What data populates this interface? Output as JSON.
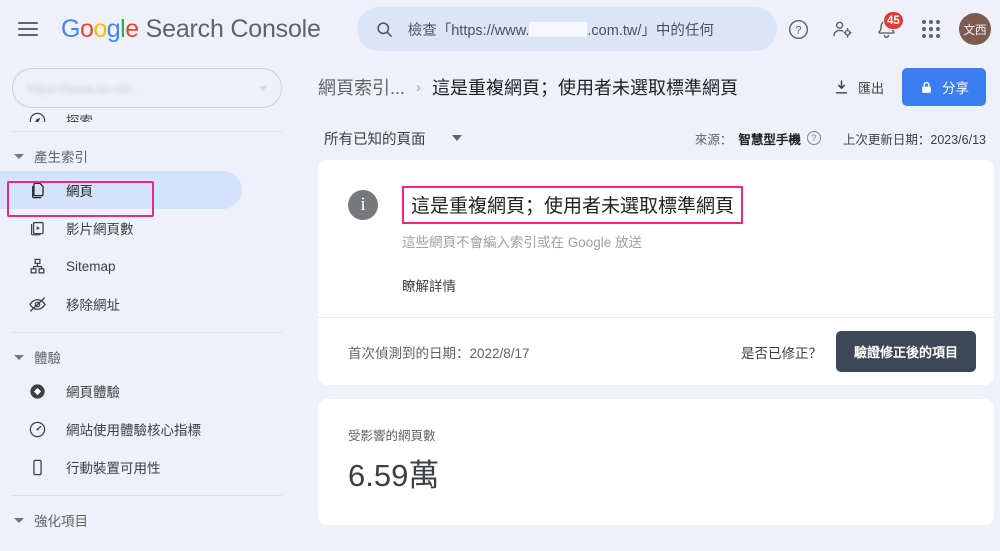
{
  "header": {
    "menu_icon": "hamburger-icon",
    "logo": {
      "g1": "G",
      "o1": "o",
      "o2": "o",
      "g2": "g",
      "l": "l",
      "e": "e",
      "rest": "Search Console"
    },
    "search": {
      "icon": "search-icon",
      "prefix": "檢查「https://www.",
      "suffix": ".com.tw/」中的任何"
    },
    "icons": {
      "help": "help-icon",
      "account_settings": "account-settings-icon",
      "notifications": "bell-icon",
      "notification_count": "45",
      "apps": "apps-grid-icon"
    },
    "avatar_text": "文西"
  },
  "sidebar": {
    "property_selector": {
      "value": "https://www.xx-vin...",
      "caret": "chevron-down-icon"
    },
    "explore_item": {
      "icon": "explore-icon",
      "label": "探索"
    },
    "sections": [
      {
        "header": "產生索引",
        "items": [
          {
            "icon": "pages-icon",
            "label": "網頁",
            "active": true
          },
          {
            "icon": "video-pages-icon",
            "label": "影片網頁數",
            "active": false
          },
          {
            "icon": "sitemap-icon",
            "label": "Sitemap",
            "active": false
          },
          {
            "icon": "removals-icon",
            "label": "移除網址",
            "active": false
          }
        ]
      },
      {
        "header": "體驗",
        "items": [
          {
            "icon": "page-experience-icon",
            "label": "網頁體驗",
            "active": false
          },
          {
            "icon": "core-web-vitals-icon",
            "label": "網站使用體驗核心指標",
            "active": false
          },
          {
            "icon": "mobile-usability-icon",
            "label": "行動裝置可用性",
            "active": false
          }
        ]
      },
      {
        "header": "強化項目",
        "items": []
      }
    ]
  },
  "main": {
    "breadcrumb": {
      "parent": "網頁索引...",
      "separator": "›",
      "current": "這是重複網頁；使用者未選取標準網頁"
    },
    "actions": {
      "export": {
        "icon": "download-icon",
        "label": "匯出"
      },
      "share": {
        "icon": "lock-icon",
        "label": "分享"
      }
    },
    "filter": {
      "label": "所有已知的頁面",
      "caret": "chevron-down-icon"
    },
    "meta": {
      "source_label": "來源：",
      "source_value": "智慧型手機",
      "source_help": "help-icon",
      "updated": "上次更新日期：2023/6/13"
    },
    "issue_card": {
      "info_icon": "info-icon",
      "title": "這是重複網頁；使用者未選取標準網頁",
      "description": "這些網頁不會編入索引或在 Google 放送",
      "learn_more": "瞭解詳情",
      "first_detected": "首次偵測到的日期：2022/8/17",
      "fixed_question": "是否已修正？",
      "validate_button": "驗證修正後的項目"
    },
    "metric_card": {
      "label": "受影響的網頁數",
      "value": "6.59萬"
    }
  },
  "colors": {
    "page_bg": "#eef1fa",
    "accent_blue": "#3b7ef2",
    "active_nav": "#d3e3fd",
    "annotation_pink": "#f0277f",
    "badge_red": "#e53935",
    "avatar_brown": "#7a5c50",
    "validate_button": "#3c4858"
  }
}
